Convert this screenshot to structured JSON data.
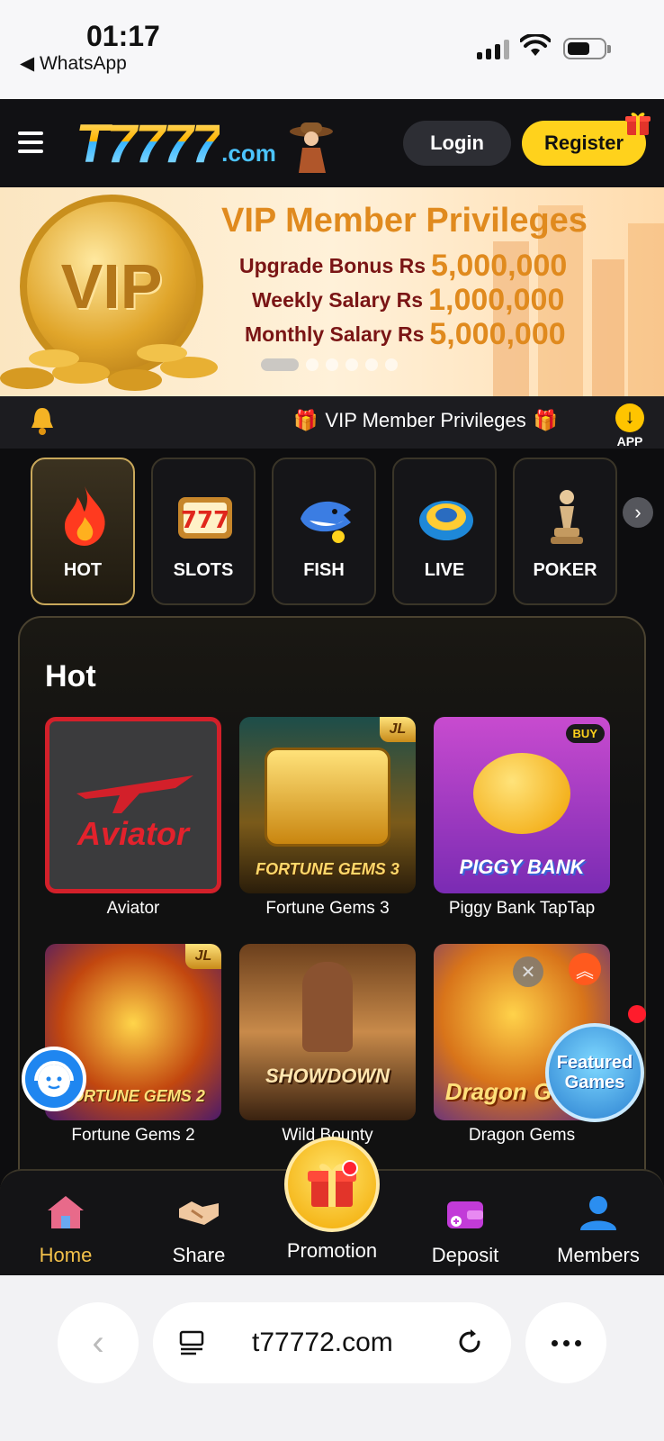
{
  "status_bar": {
    "time": "01:17",
    "back_app": "◀ WhatsApp"
  },
  "header": {
    "logo_main": "T7777",
    "logo_suffix": ".com",
    "login_label": "Login",
    "register_label": "Register"
  },
  "banner": {
    "coin_text": "VIP",
    "title": "VIP Member Privileges",
    "rows": [
      {
        "label": "Upgrade Bonus Rs",
        "amount": "5,000,000"
      },
      {
        "label": "Weekly Salary Rs",
        "amount": "1,000,000"
      },
      {
        "label": "Monthly Salary Rs",
        "amount": "5,000,000"
      }
    ],
    "slide_count": 6,
    "active_slide": 1
  },
  "ticker": {
    "text": "VIP Member Privileges",
    "app_label": "APP"
  },
  "categories": [
    {
      "label": "HOT",
      "icon": "flame-icon",
      "active": true
    },
    {
      "label": "SLOTS",
      "icon": "slot-777-icon",
      "active": false
    },
    {
      "label": "FISH",
      "icon": "shark-icon",
      "active": false
    },
    {
      "label": "LIVE",
      "icon": "roulette-icon",
      "active": false
    },
    {
      "label": "POKER",
      "icon": "chess-pawn-icon",
      "active": false
    }
  ],
  "hot_section": {
    "title": "Hot",
    "games": [
      {
        "name": "Aviator",
        "thumb_text": "Aviator"
      },
      {
        "name": "Fortune Gems 3",
        "thumb_text": "FORTUNE GEMS 3",
        "badge": "JL"
      },
      {
        "name": "Piggy Bank TapTap",
        "thumb_text": "PIGGY BANK",
        "badge": "BUY"
      },
      {
        "name": "Fortune Gems 2",
        "thumb_text": "FORTUNE GEMS 2",
        "badge": "JL"
      },
      {
        "name": "Wild Bounty Showdown",
        "thumb_text": "SHOWDOWN"
      },
      {
        "name": "Dragon Gems",
        "thumb_text": "Dragon Gems"
      }
    ]
  },
  "featured_label": "Featured Games",
  "bottom_nav": [
    {
      "label": "Home",
      "icon": "home-icon",
      "active": true
    },
    {
      "label": "Share",
      "icon": "handshake-icon",
      "active": false
    },
    {
      "label": "Promotion",
      "icon": "gift-icon",
      "active": false
    },
    {
      "label": "Deposit",
      "icon": "wallet-icon",
      "active": false
    },
    {
      "label": "Members",
      "icon": "user-icon",
      "active": false
    }
  ],
  "browser": {
    "url": "t77772.com"
  },
  "colors": {
    "accent": "#ffd21c",
    "gold_border": "#c9a85b",
    "background": "#0d0d0f"
  }
}
